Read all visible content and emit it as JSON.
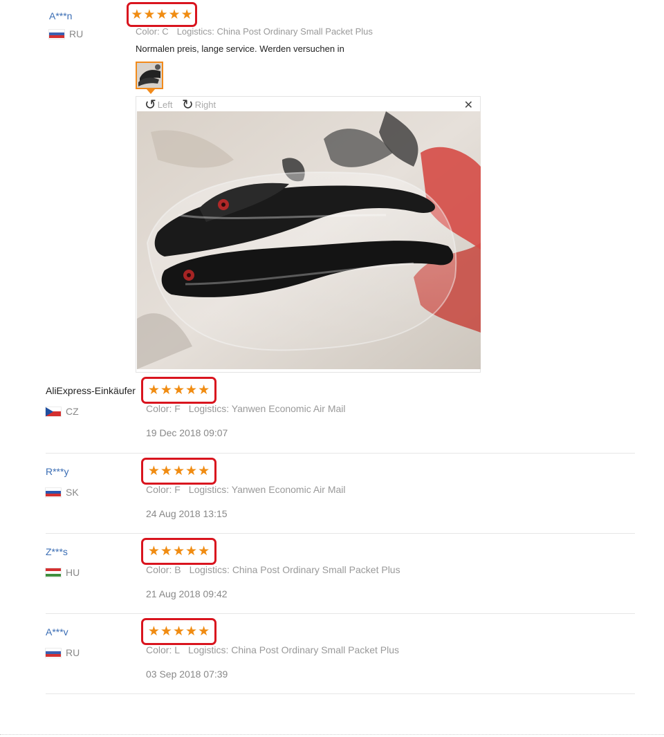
{
  "rotate": {
    "left_label": "Left",
    "right_label": "Right"
  },
  "comment_text": "Normalen preis, lange service. Werden versuchen in",
  "reviews": [
    {
      "user": "A***n",
      "country": "RU",
      "rating": 5,
      "color": "Color: C",
      "logistics": "Logistics: China Post Ordinary Small Packet Plus",
      "date": ""
    },
    {
      "user": "AliExpress-Einkäufer",
      "country": "CZ",
      "rating": 5,
      "color": "Color: F",
      "logistics": "Logistics: Yanwen Economic Air Mail",
      "date": "19 Dec 2018 09:07"
    },
    {
      "user": "R***y",
      "country": "SK",
      "rating": 5,
      "color": "Color: F",
      "logistics": "Logistics: Yanwen Economic Air Mail",
      "date": "24 Aug 2018 13:15"
    },
    {
      "user": "Z***s",
      "country": "HU",
      "rating": 5,
      "color": "Color: B",
      "logistics": "Logistics: China Post Ordinary Small Packet Plus",
      "date": "21 Aug 2018 09:42"
    },
    {
      "user": "A***v",
      "country": "RU",
      "rating": 5,
      "color": "Color: L",
      "logistics": "Logistics: China Post Ordinary Small Packet Plus",
      "date": "03 Sep 2018 07:39"
    }
  ],
  "colors": {
    "star": "#f08c12",
    "highlight": "#d9141e",
    "link": "#3a6db4",
    "thumb_border": "#f28a1a"
  },
  "icons": {
    "rotate_left": "rotate-left-icon",
    "rotate_right": "rotate-right-icon",
    "close": "close-icon",
    "star": "star-icon"
  }
}
